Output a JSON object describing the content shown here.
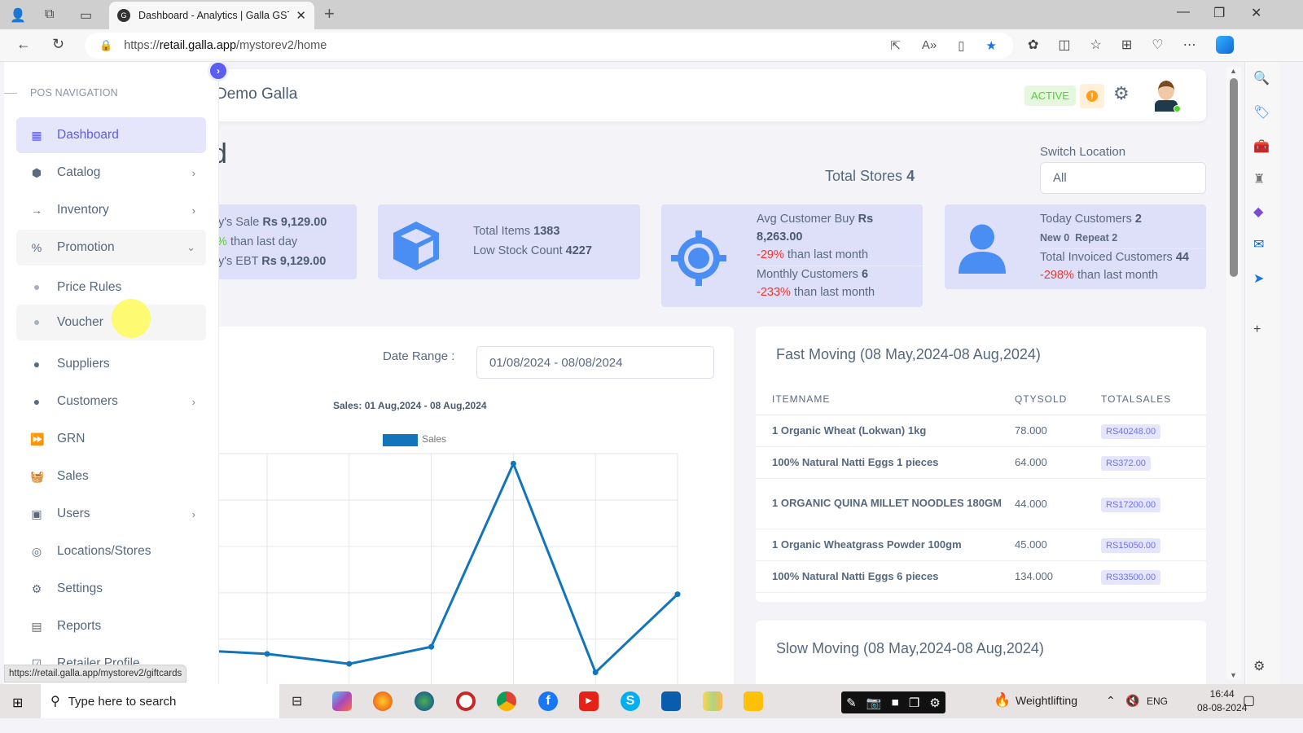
{
  "browser": {
    "tab_title": "Dashboard - Analytics | Galla GST",
    "url_scheme": "https://",
    "url_host": "retail.galla.app",
    "url_path": "/mystorev2/home",
    "status_url": "https://retail.galla.app/mystorev2/giftcards"
  },
  "header": {
    "brand": "Demo Galla",
    "status_badge": "ACTIVE",
    "warn_icon": "!"
  },
  "sidebar": {
    "heading": "POS NAVIGATION",
    "items": [
      {
        "label": "Dashboard",
        "icon": "dashboard-icon",
        "glyph": "▦",
        "chevron": ""
      },
      {
        "label": "Catalog",
        "icon": "box-icon",
        "glyph": "⬢",
        "chevron": "›"
      },
      {
        "label": "Inventory",
        "icon": "arrow-right-icon",
        "glyph": "→",
        "chevron": "›"
      },
      {
        "label": "Promotion",
        "icon": "percent-ticket-icon",
        "glyph": "%",
        "chevron": "⌄"
      },
      {
        "label": "Price Rules"
      },
      {
        "label": "Voucher"
      },
      {
        "label": "Suppliers",
        "icon": "user-circle-icon",
        "glyph": "●",
        "chevron": ""
      },
      {
        "label": "Customers",
        "icon": "user-circle-icon",
        "glyph": "●",
        "chevron": "›"
      },
      {
        "label": "GRN",
        "icon": "fast-forward-icon",
        "glyph": "⏩",
        "chevron": ""
      },
      {
        "label": "Sales",
        "icon": "basket-icon",
        "glyph": "🧺",
        "chevron": ""
      },
      {
        "label": "Users",
        "icon": "users-card-icon",
        "glyph": "▣",
        "chevron": "›"
      },
      {
        "label": "Locations/Stores",
        "icon": "map-pin-icon",
        "glyph": "◎",
        "chevron": ""
      },
      {
        "label": "Settings",
        "icon": "settings-icon",
        "glyph": "⚙",
        "chevron": ""
      },
      {
        "label": "Reports",
        "icon": "report-file-icon",
        "glyph": "▤",
        "chevron": ""
      },
      {
        "label": "Retailer Profile",
        "icon": "profile-icon",
        "glyph": "☑",
        "chevron": ""
      }
    ]
  },
  "page": {
    "title_fragment": "d",
    "total_stores_label": "Total Stores",
    "total_stores_value": "4",
    "switch_location_label": "Switch Location",
    "switch_location_value": "All"
  },
  "stats": {
    "sales": {
      "today_sale_label": "y's Sale",
      "today_sale_value": "Rs 9,129.00",
      "change_frag": "%",
      "change_text": "than last day",
      "ebt_label": "y's EBT",
      "ebt_value": "Rs 9,129.00"
    },
    "items": {
      "total_items_label": "Total Items",
      "total_items_value": "1383",
      "low_stock_label": "Low Stock Count",
      "low_stock_value": "4227"
    },
    "avg": {
      "avg_label": "Avg Customer Buy",
      "avg_currency": "Rs",
      "avg_value": "8,263.00",
      "avg_change": "-29%",
      "avg_change_text": "than last month",
      "monthly_label": "Monthly Customers",
      "monthly_value": "6",
      "monthly_change": "-233%",
      "monthly_change_text": "than last month"
    },
    "customers": {
      "today_label": "Today Customers",
      "today_value": "2",
      "new_label": "New",
      "new_value": "0",
      "repeat_label": "Repeat",
      "repeat_value": "2",
      "invoiced_label": "Total Invoiced Customers",
      "invoiced_value": "44",
      "invoiced_change": "-298%",
      "invoiced_change_text": "than last month"
    }
  },
  "sales_chart": {
    "date_range_label": "Date Range :",
    "date_range_value": "01/08/2024 - 08/08/2024"
  },
  "chart_data": {
    "type": "line",
    "title": "Sales: 01 Aug,2024 - 08 Aug,2024",
    "legend": [
      "Sales"
    ],
    "legend_position": "top",
    "series": [
      {
        "name": "Sales",
        "color": "#1275bb",
        "values": [
          2100,
          1950,
          1600,
          2200,
          8650,
          1300,
          4050
        ]
      }
    ],
    "x": [
      "",
      "",
      "",
      "",
      "",
      "",
      ""
    ],
    "ylim": [
      1000,
      9000
    ],
    "grid": true,
    "xlabel": "",
    "ylabel": ""
  },
  "fast_moving": {
    "title": "Fast Moving (08 May,2024-08 Aug,2024)",
    "columns": [
      "ITEMNAME",
      "QTYSOLD",
      "TOTALSALES"
    ],
    "rows": [
      {
        "name": "1 Organic Wheat (Lokwan) 1kg",
        "qty": "78.000",
        "total": "RS40248.00"
      },
      {
        "name": "100% Natural Natti Eggs 1 pieces",
        "qty": "64.000",
        "total": "RS372.00"
      },
      {
        "name": "1 ORGANIC QUINA MILLET NOODLES 180GM",
        "qty": "44.000",
        "total": "RS17200.00"
      },
      {
        "name": "1 Organic Wheatgrass Powder 100gm",
        "qty": "45.000",
        "total": "RS15050.00"
      },
      {
        "name": "100% Natural Natti Eggs 6 pieces",
        "qty": "134.000",
        "total": "RS33500.00"
      }
    ]
  },
  "slow_moving": {
    "title": "Slow Moving (08 May,2024-08 Aug,2024)"
  },
  "taskbar": {
    "search_placeholder": "Type here to search",
    "weather": "Weightlifting",
    "lang": "ENG",
    "time": "16:44",
    "date": "08-08-2024"
  }
}
